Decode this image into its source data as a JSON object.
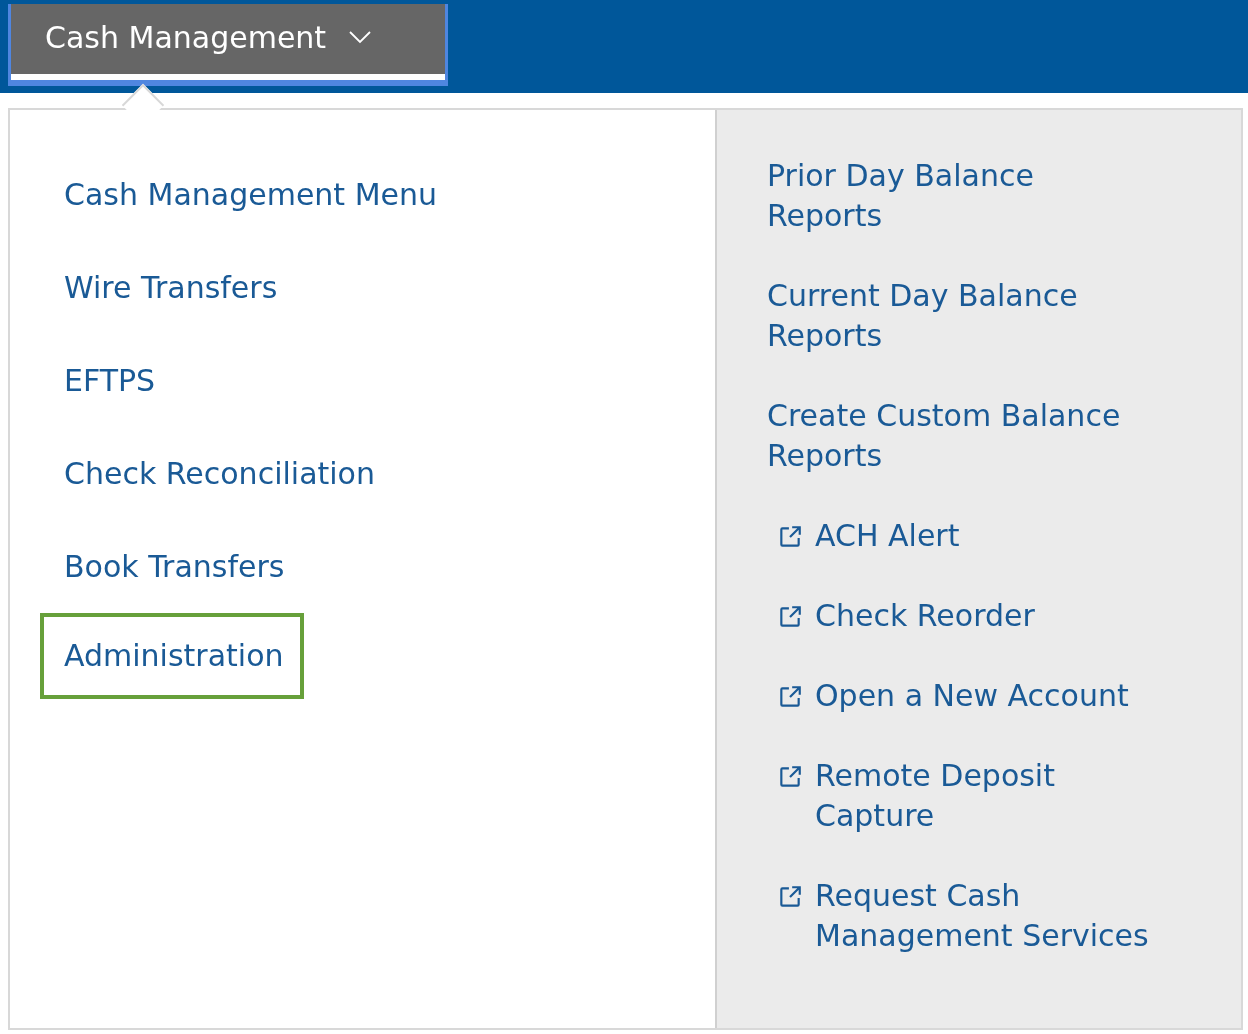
{
  "nav": {
    "tab": {
      "label": "Cash Management",
      "expanded": true
    }
  },
  "menu": {
    "left_items": [
      {
        "label": "Cash Management Menu",
        "highlighted": false
      },
      {
        "label": "Wire Transfers",
        "highlighted": false
      },
      {
        "label": "EFTPS",
        "highlighted": false
      },
      {
        "label": "Check Reconciliation",
        "highlighted": false
      },
      {
        "label": "Book Transfers",
        "highlighted": false
      },
      {
        "label": "Administration",
        "highlighted": true
      }
    ],
    "right_items": [
      {
        "label": "Prior Day Balance Reports",
        "kind": "internal"
      },
      {
        "label": "Current Day Balance Reports",
        "kind": "internal"
      },
      {
        "label": "Create Custom Balance Reports",
        "kind": "internal"
      },
      {
        "label": "ACH Alert",
        "kind": "external"
      },
      {
        "label": "Check Reorder",
        "kind": "external"
      },
      {
        "label": "Open a New Account",
        "kind": "external"
      },
      {
        "label": "Remote Deposit Capture",
        "kind": "external"
      },
      {
        "label": "Request Cash Management Services",
        "kind": "external"
      }
    ]
  }
}
